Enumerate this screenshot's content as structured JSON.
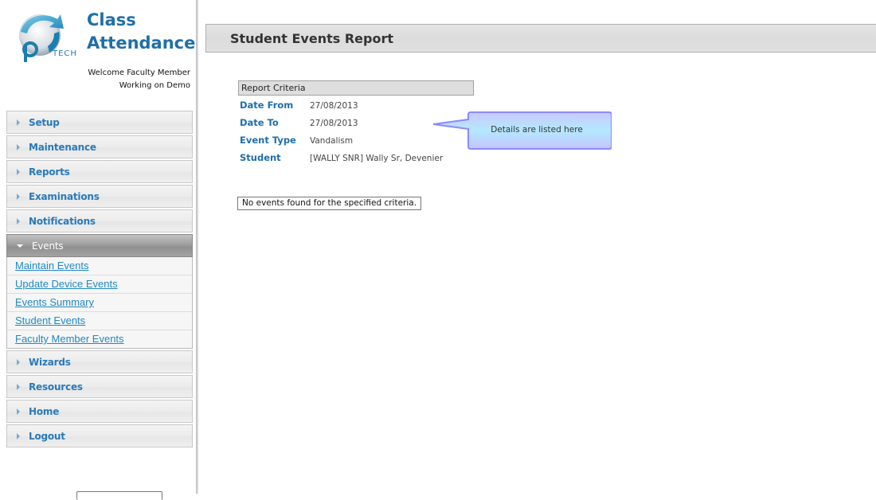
{
  "app": {
    "title_line1": "Class",
    "title_line2": "Attendance",
    "logo_text": "TECH",
    "welcome": "Welcome Faculty Member",
    "working_on": "Working on Demo"
  },
  "sidebar": {
    "items_before": [
      {
        "label": "Setup"
      },
      {
        "label": "Maintenance"
      },
      {
        "label": "Reports"
      },
      {
        "label": "Examinations"
      },
      {
        "label": "Notifications"
      }
    ],
    "active": {
      "label": "Events"
    },
    "submenu": [
      {
        "label": "Maintain Events"
      },
      {
        "label": "Update Device Events"
      },
      {
        "label": "Events Summary"
      },
      {
        "label": "Student Events"
      },
      {
        "label": "Faculty Member Events"
      }
    ],
    "items_after": [
      {
        "label": "Wizards"
      },
      {
        "label": "Resources"
      },
      {
        "label": "Home"
      },
      {
        "label": "Logout"
      }
    ]
  },
  "main": {
    "page_title": "Student Events Report",
    "criteria_heading": "Report Criteria",
    "criteria": [
      {
        "label": "Date From",
        "value": "27/08/2013"
      },
      {
        "label": "Date To",
        "value": "27/08/2013"
      },
      {
        "label": "Event Type",
        "value": "Vandalism"
      },
      {
        "label": "Student",
        "value": "[WALLY SNR] Wally Sr, Devenier"
      }
    ],
    "no_events_message": "No events found for the specified criteria.",
    "callout_text": "Details are listed here"
  },
  "colors": {
    "brand_blue": "#1f6fa8",
    "link_blue": "#2189c3",
    "callout_fill": "#b8d8ff"
  }
}
